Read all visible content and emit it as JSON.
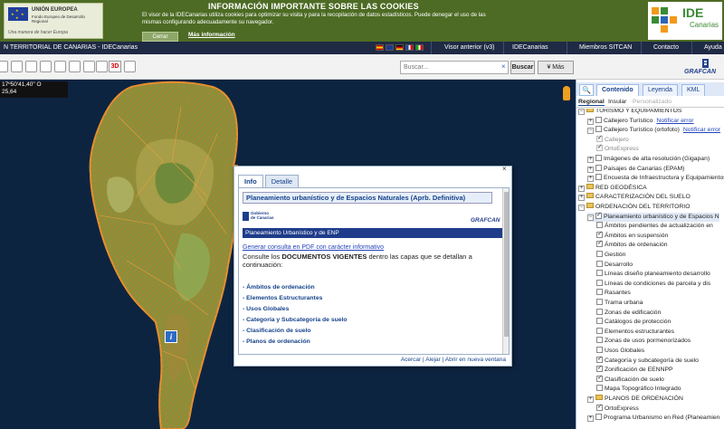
{
  "cookie": {
    "title": "INFORMACIÓN IMPORTANTE SOBRE LAS COOKIES",
    "text": "El visor de la IDECanarias utiliza cookies para optimizar su visita y para la recopilación de datos estadísticos. Puede denegar el uso de las mismas configurando adecuadamente su navegador.",
    "close_label": "Cerrar",
    "more_label": "Más información",
    "eu_line1": "UNIÓN EUROPEA",
    "eu_line2": "Fondo Europeo de Desarrollo Regional",
    "eu_slogan": "Una manera de hacer Europa",
    "ide_text": "IDE",
    "ide_sub": "Canarias"
  },
  "nav": {
    "title": "N TERRITORIAL DE CANARIAS - IDECanarias",
    "links": [
      "Visor anterior (v3)",
      "IDECanarias",
      "Miembros SITCAN",
      "Contacto",
      "Ayuda"
    ]
  },
  "toolbar": {
    "btn_3d": "3D",
    "search_placeholder": "Buscar...",
    "search_clear": "×",
    "search_label": "Buscar",
    "more_label": "¥ Más",
    "grafcan": "GRAFCAN"
  },
  "map": {
    "coord_line1": "17º50'41,40\" O",
    "coord_line2": "25,64",
    "info_marker": "i"
  },
  "popup": {
    "close": "×",
    "tabs": [
      "Info",
      "Detalle"
    ],
    "heading": "Planeamiento urbanístico y de Espacios Naturales (Aprb. Definitiva)",
    "gob_line1": "Gobierno",
    "gob_line2": "de Canarias",
    "grafcan": "GRAFCAN",
    "bar": "Planeamiento Urbanístico y de ENP",
    "pdf_link": "Generar consulta en PDF con carácter informativo",
    "docs_pre": "Consulte los ",
    "docs_bold": "DOCUMENTOS VIGENTES",
    "docs_post": " dentro las capas que se detallan a continuación:",
    "items": [
      "- Ámbitos de ordenación",
      "- Elementos Estructurantes",
      "- Usos Globales",
      "- Categoría y Subcategoría de suelo",
      "- Clasificación de suelo",
      "- Planos de ordenación"
    ],
    "footer_acercar": "Acercar",
    "footer_alejar": "Alejar",
    "footer_nueva": "Abrir en nueva ventana",
    "footer_sep": "|"
  },
  "panel": {
    "search_icon": "🔍",
    "tabs": [
      "Contenido",
      "Leyenda",
      "KML"
    ],
    "subtabs": [
      "Regional",
      "Insular",
      "Personalizado"
    ],
    "tree": [
      {
        "label": "TURISMO Y EQUIPAMIENTOS",
        "indent": 0,
        "type": "folder",
        "toggle": "−"
      },
      {
        "label": "Callejero Turístico",
        "indent": 1,
        "type": "layer",
        "toggle": "+",
        "checked": false,
        "error": "Notificar error"
      },
      {
        "label": "Callejero Turístico (ortofoto)",
        "indent": 1,
        "type": "layer",
        "toggle": "−",
        "checked": false,
        "error": "Notificar error"
      },
      {
        "label": "Callejero",
        "indent": 2,
        "type": "sub",
        "checked": true,
        "disabled": true
      },
      {
        "label": "OrtoExpress",
        "indent": 2,
        "type": "sub",
        "checked": true,
        "disabled": true
      },
      {
        "label": "Imágenes de alta resolución (Gigapan)",
        "indent": 1,
        "type": "layer",
        "toggle": "+",
        "checked": false
      },
      {
        "label": "Paisajes de Canarias (EPAM)",
        "indent": 1,
        "type": "layer",
        "toggle": "+",
        "checked": false
      },
      {
        "label": "Encuesta de Infraestructura y Equipamientos",
        "indent": 1,
        "type": "layer",
        "toggle": "+",
        "checked": false
      },
      {
        "label": "RED GEODÉSICA",
        "indent": 0,
        "type": "folder",
        "toggle": "+"
      },
      {
        "label": "CARACTERIZACIÓN DEL SUELO",
        "indent": 0,
        "type": "folder",
        "toggle": "+"
      },
      {
        "label": "ORDENACIÓN DEL TERRITORIO",
        "indent": 0,
        "type": "folder",
        "toggle": "−"
      },
      {
        "label": "Planeamiento urbanístico y de Espacios N",
        "indent": 1,
        "type": "layer",
        "toggle": "−",
        "checked": true,
        "selected": true
      },
      {
        "label": "Ámbitos pendientes de actualización en",
        "indent": 2,
        "type": "sub",
        "checked": false
      },
      {
        "label": "Ámbitos en suspensión",
        "indent": 2,
        "type": "sub",
        "checked": true
      },
      {
        "label": "Ámbitos de ordenación",
        "indent": 2,
        "type": "sub",
        "checked": true
      },
      {
        "label": "Gestión",
        "indent": 2,
        "type": "sub",
        "checked": false
      },
      {
        "label": "Desarrollo",
        "indent": 2,
        "type": "sub",
        "checked": false
      },
      {
        "label": "Líneas diseño planeamiento desarrollo",
        "indent": 2,
        "type": "sub",
        "checked": false
      },
      {
        "label": "Líneas de condiciones de parcela y dis",
        "indent": 2,
        "type": "sub",
        "checked": false
      },
      {
        "label": "Rasantes",
        "indent": 2,
        "type": "sub",
        "checked": false
      },
      {
        "label": "Trama urbana",
        "indent": 2,
        "type": "sub",
        "checked": false
      },
      {
        "label": "Zonas de edificación",
        "indent": 2,
        "type": "sub",
        "checked": false
      },
      {
        "label": "Catálogos de protección",
        "indent": 2,
        "type": "sub",
        "checked": false
      },
      {
        "label": "Elementos estructurantes",
        "indent": 2,
        "type": "sub",
        "checked": false
      },
      {
        "label": "Zonas de usos pormenorizados",
        "indent": 2,
        "type": "sub",
        "checked": false
      },
      {
        "label": "Usos Globales",
        "indent": 2,
        "type": "sub",
        "checked": false
      },
      {
        "label": "Categoría y subcategoría de suelo",
        "indent": 2,
        "type": "sub",
        "checked": true
      },
      {
        "label": "Zonificación de EENNPP",
        "indent": 2,
        "type": "sub",
        "checked": true
      },
      {
        "label": "Clasificación de suelo",
        "indent": 2,
        "type": "sub",
        "checked": true
      },
      {
        "label": "Mapa Topográfico Integrado",
        "indent": 2,
        "type": "sub",
        "checked": false
      },
      {
        "label": "PLANOS DE ORDENACIÓN",
        "indent": 1,
        "type": "folder",
        "toggle": "+"
      },
      {
        "label": "OrtoExpress",
        "indent": 2,
        "type": "sub",
        "checked": true
      },
      {
        "label": "Programa Urbanismo en Red (Planeamien",
        "indent": 1,
        "type": "layer",
        "toggle": "+",
        "checked": false
      }
    ]
  }
}
